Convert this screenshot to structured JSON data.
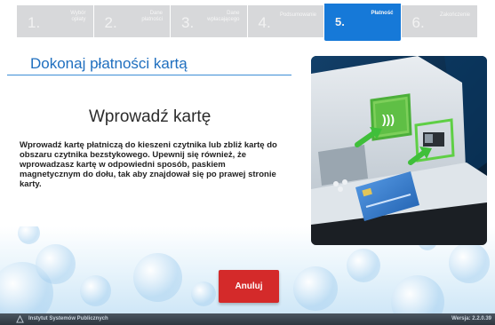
{
  "steps": [
    {
      "num": "1.",
      "label": "Wybór\nopłaty"
    },
    {
      "num": "2.",
      "label": "Dane\npłatności"
    },
    {
      "num": "3.",
      "label": "Dane\nwpłacającego"
    },
    {
      "num": "4.",
      "label": "Podsumowanie"
    },
    {
      "num": "5.",
      "label": "Płatność"
    },
    {
      "num": "6.",
      "label": "Zakończenie"
    }
  ],
  "active_step": 5,
  "page_title": "Dokonaj płatności kartą",
  "heading": "Wprowadź kartę",
  "description": "Wprowadź kartę płatniczą do kieszeni czytnika lub zbliż kartę do obszaru czytnika bezstykowego. Upewnij się również, że wprowadzasz kartę w odpowiedni sposób, paskiem magnetycznym do dołu, tak aby znajdował się po prawej stronie karty.",
  "cancel_label": "Anuluj",
  "footer": {
    "org": "Instytut Systemów Publicznych",
    "version": "Wersja: 2.2.0.39"
  },
  "colors": {
    "accent": "#1679d8",
    "cancel": "#d42a2a",
    "step_inactive": "#d7d8da"
  }
}
